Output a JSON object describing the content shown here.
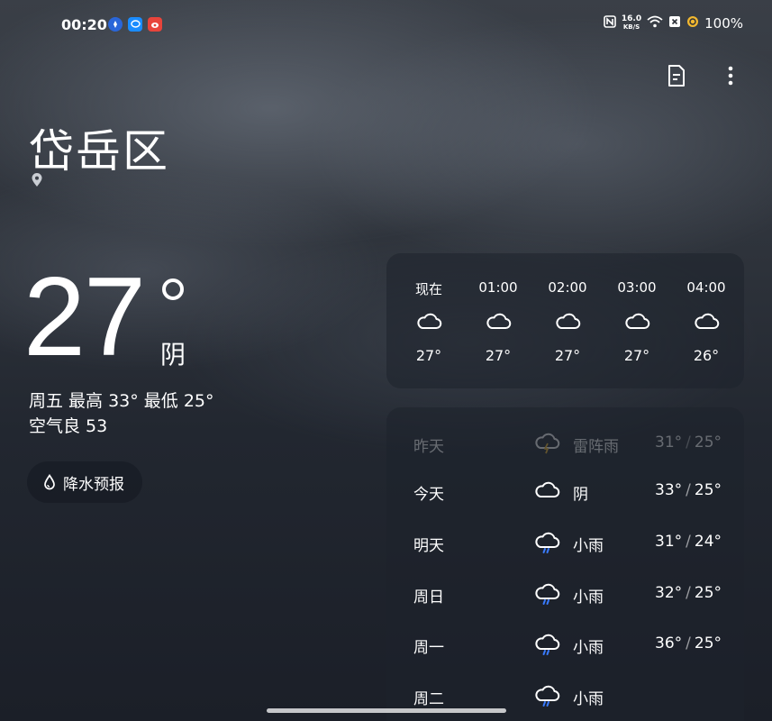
{
  "status_bar": {
    "time": "00:20",
    "net_speed_top": "16.0",
    "net_speed_unit": "KB/S",
    "battery": "100%"
  },
  "location": {
    "name": "岱岳区"
  },
  "current": {
    "temperature": "27",
    "condition": "阴",
    "day_summary": "周五 最高 33° 最低 25°",
    "air_quality": "空气良 53"
  },
  "precip_button": {
    "label": "降水预报"
  },
  "hourly": [
    {
      "time": "现在",
      "icon": "cloudy-icon",
      "temp": "27°"
    },
    {
      "time": "01:00",
      "icon": "cloudy-icon",
      "temp": "27°"
    },
    {
      "time": "02:00",
      "icon": "cloudy-icon",
      "temp": "27°"
    },
    {
      "time": "03:00",
      "icon": "cloudy-icon",
      "temp": "27°"
    },
    {
      "time": "04:00",
      "icon": "cloudy-icon",
      "temp": "26°"
    }
  ],
  "daily": [
    {
      "day": "昨天",
      "icon": "thunderstorm-icon",
      "condition": "雷阵雨",
      "high": "31°",
      "low": "25°",
      "past": true
    },
    {
      "day": "今天",
      "icon": "cloudy-icon",
      "condition": "阴",
      "high": "33°",
      "low": "25°",
      "past": false
    },
    {
      "day": "明天",
      "icon": "light-rain-icon",
      "condition": "小雨",
      "high": "31°",
      "low": "24°",
      "past": false
    },
    {
      "day": "周日",
      "icon": "light-rain-icon",
      "condition": "小雨",
      "high": "32°",
      "low": "25°",
      "past": false
    },
    {
      "day": "周一",
      "icon": "light-rain-icon",
      "condition": "小雨",
      "high": "36°",
      "low": "25°",
      "past": false
    },
    {
      "day": "周二",
      "icon": "light-rain-icon",
      "condition": "小雨",
      "high": "",
      "low": "",
      "past": false
    }
  ],
  "colors": {
    "rain_accent": "#3a7bff",
    "bolt_accent": "#f2b830"
  }
}
